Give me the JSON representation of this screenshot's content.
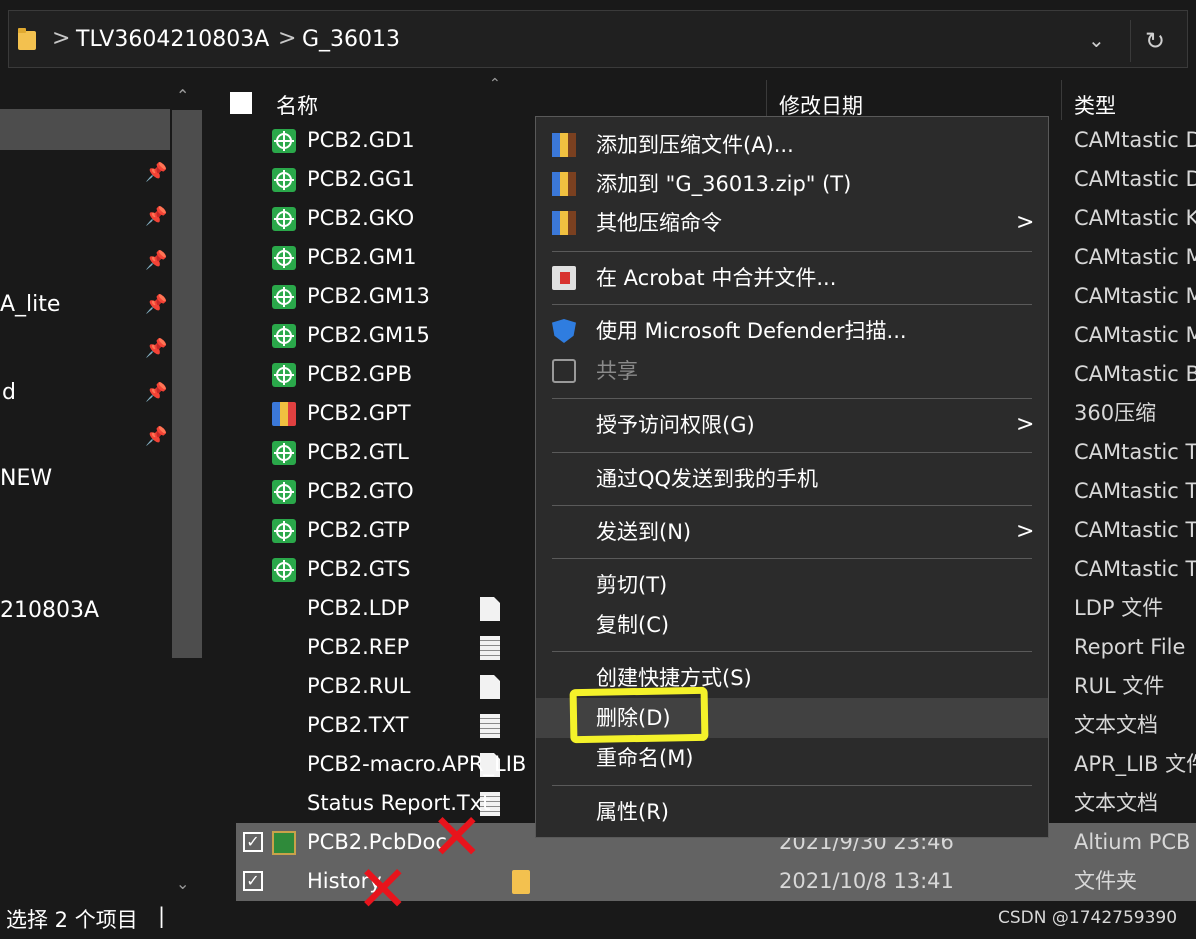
{
  "address_bar": {
    "crumbs": [
      "TLV3604210803A",
      "G_36013"
    ],
    "separator": ">",
    "dropdown_icon": "chevron-down-icon",
    "refresh_icon": "refresh-icon"
  },
  "nav_pane": {
    "items": [
      "A_lite",
      "d",
      "NEW",
      "210803A"
    ],
    "pin_icon": "pin-icon"
  },
  "columns": {
    "name": "名称",
    "date": "修改日期",
    "type": "类型"
  },
  "files": [
    {
      "name": "PCB2.GD1",
      "type": "CAMtastic D",
      "icon": "gerber-icon"
    },
    {
      "name": "PCB2.GG1",
      "type": "CAMtastic D",
      "icon": "gerber-icon"
    },
    {
      "name": "PCB2.GKO",
      "type": "CAMtastic K",
      "icon": "gerber-icon"
    },
    {
      "name": "PCB2.GM1",
      "type": "CAMtastic M",
      "icon": "gerber-icon"
    },
    {
      "name": "PCB2.GM13",
      "type": "CAMtastic M",
      "icon": "gerber-icon"
    },
    {
      "name": "PCB2.GM15",
      "type": "CAMtastic M",
      "icon": "gerber-icon"
    },
    {
      "name": "PCB2.GPB",
      "type": "CAMtastic B",
      "icon": "gerber-icon"
    },
    {
      "name": "PCB2.GPT",
      "type": "360压缩",
      "icon": "archive-icon"
    },
    {
      "name": "PCB2.GTL",
      "type": "CAMtastic T",
      "icon": "gerber-icon"
    },
    {
      "name": "PCB2.GTO",
      "type": "CAMtastic T",
      "icon": "gerber-icon"
    },
    {
      "name": "PCB2.GTP",
      "type": "CAMtastic T",
      "icon": "gerber-icon"
    },
    {
      "name": "PCB2.GTS",
      "type": "CAMtastic T",
      "icon": "gerber-icon"
    },
    {
      "name": "PCB2.LDP",
      "type": "LDP 文件",
      "icon": "file-icon"
    },
    {
      "name": "PCB2.REP",
      "type": "Report File",
      "icon": "text-file-icon"
    },
    {
      "name": "PCB2.RUL",
      "type": "RUL 文件",
      "icon": "file-icon"
    },
    {
      "name": "PCB2.TXT",
      "type": "文本文档",
      "icon": "text-file-icon"
    },
    {
      "name": "PCB2-macro.APR_LIB",
      "type": "APR_LIB 文件",
      "icon": "file-icon"
    },
    {
      "name": "Status Report.Txt",
      "type": "文本文档",
      "icon": "text-file-icon"
    },
    {
      "name": "PCB2.PcbDoc",
      "date": "2021/9/30 23:46",
      "type": "Altium PCB",
      "icon": "pcb-doc-icon",
      "selected": true
    },
    {
      "name": "History",
      "date": "2021/10/8 13:41",
      "type": "文件夹",
      "icon": "folder-icon",
      "selected": true
    }
  ],
  "context_menu": {
    "add_archive": "添加到压缩文件(A)...",
    "add_zip": "添加到 \"G_36013.zip\" (T)",
    "other_compress": "其他压缩命令",
    "acrobat_merge": "在 Acrobat 中合并文件...",
    "defender_scan": "使用 Microsoft Defender扫描...",
    "share": "共享",
    "grant_access": "授予访问权限(G)",
    "qq_send": "通过QQ发送到我的手机",
    "send_to": "发送到(N)",
    "cut": "剪切(T)",
    "copy": "复制(C)",
    "create_shortcut": "创建快捷方式(S)",
    "delete": "删除(D)",
    "rename": "重命名(M)",
    "properties": "属性(R)",
    "submenu_arrow": ">"
  },
  "status_bar": {
    "text": "选择 2 个项目",
    "separator": "|",
    "watermark": "CSDN @1742759390"
  },
  "annotations": {
    "highlight_color": "#f4f22a",
    "x_mark_color": "#e8141c",
    "x_mark": "✕"
  }
}
